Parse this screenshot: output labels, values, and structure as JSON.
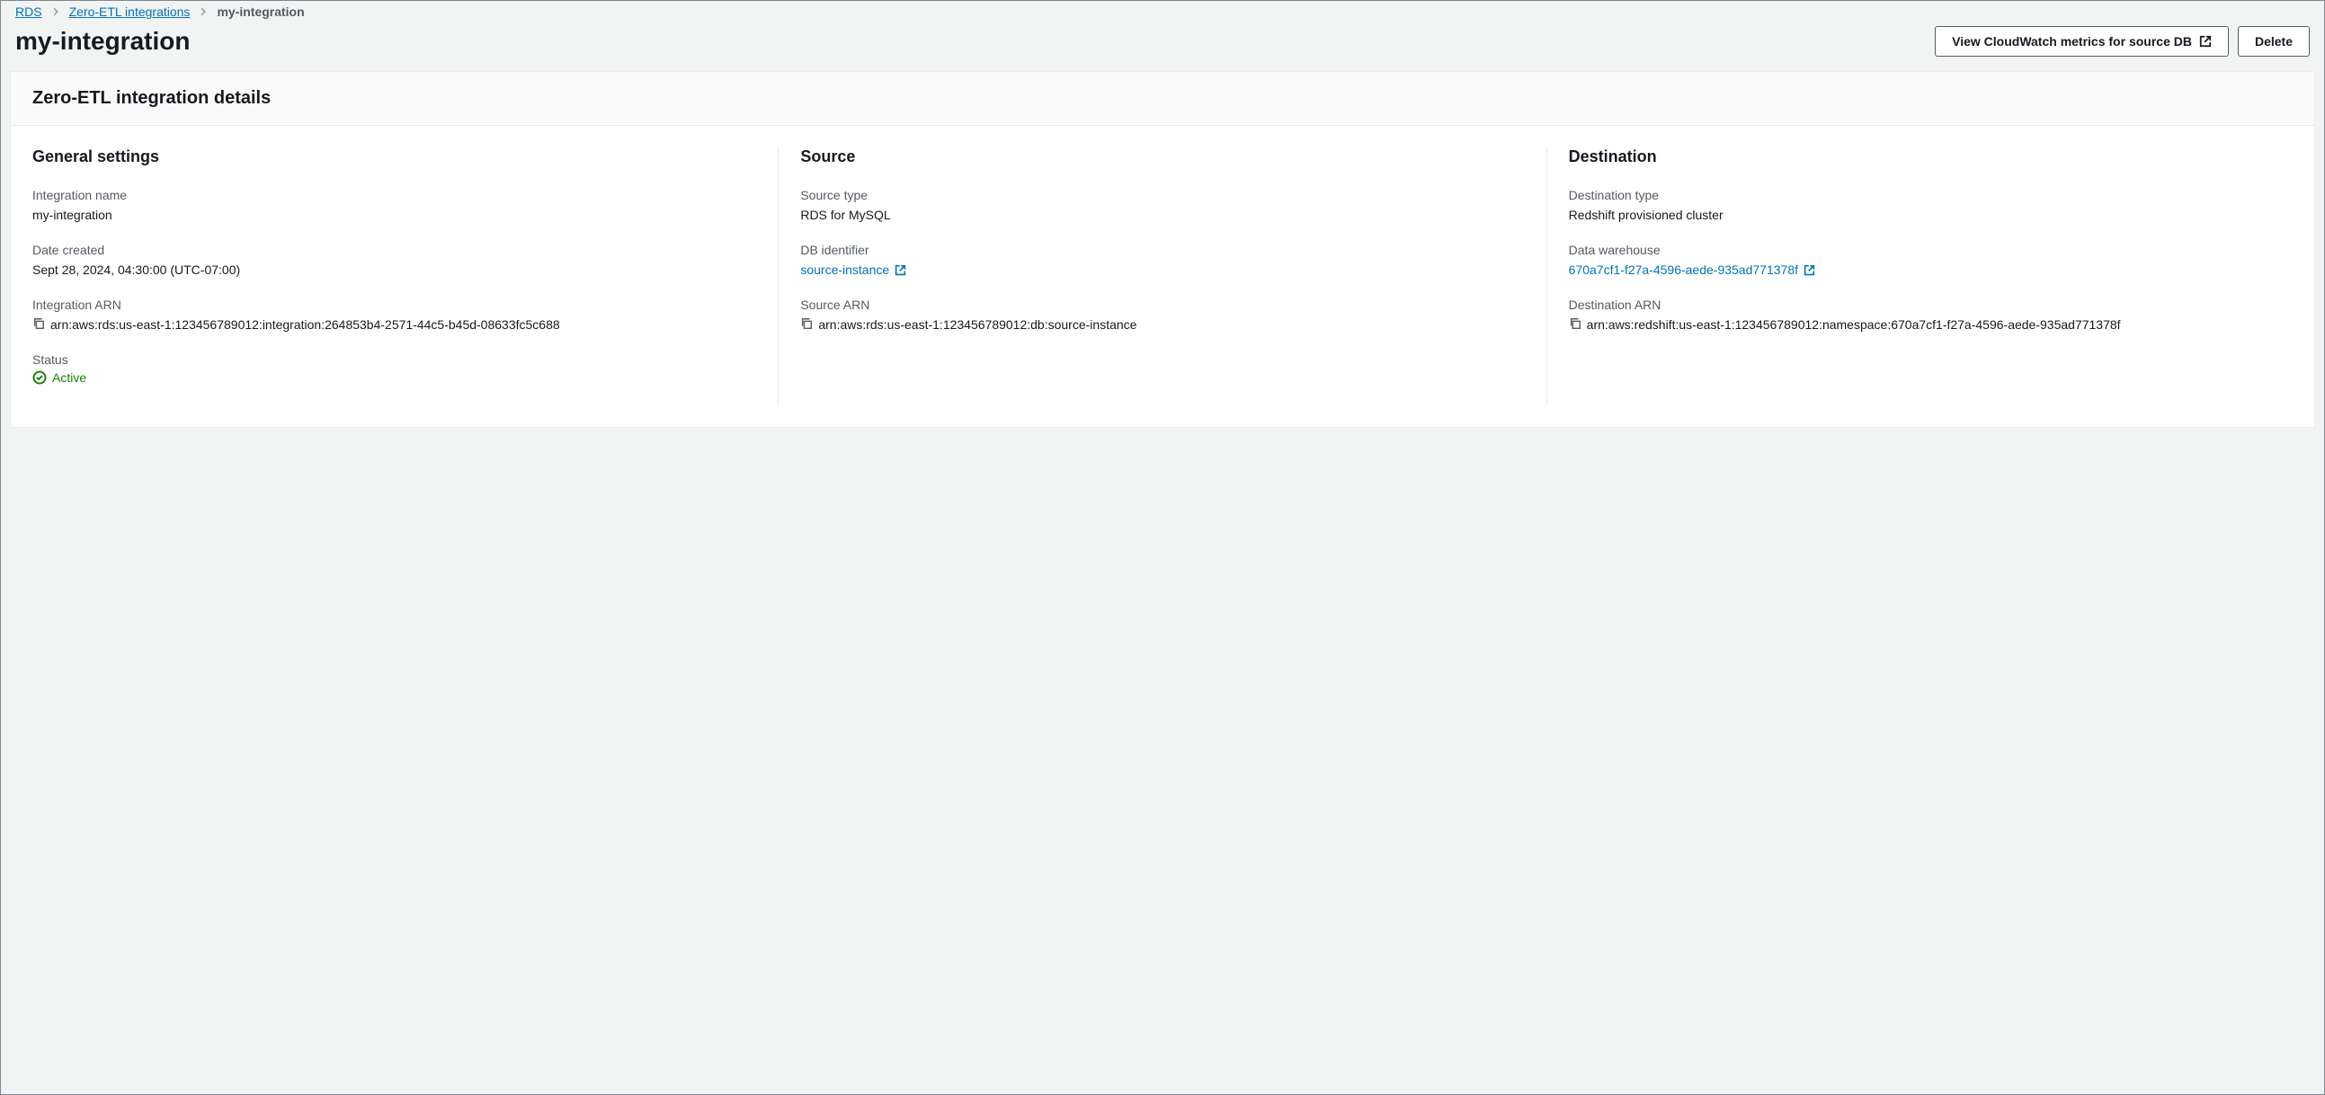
{
  "breadcrumb": {
    "rds": "RDS",
    "zero_etl": "Zero-ETL integrations",
    "current": "my-integration"
  },
  "header": {
    "title": "my-integration",
    "view_metrics_btn": "View CloudWatch metrics for source DB",
    "delete_btn": "Delete"
  },
  "panel": {
    "title": "Zero-ETL integration details"
  },
  "general": {
    "heading": "General settings",
    "integration_name_label": "Integration name",
    "integration_name_value": "my-integration",
    "date_created_label": "Date created",
    "date_created_value": "Sept 28, 2024, 04:30:00 (UTC-07:00)",
    "arn_label": "Integration ARN",
    "arn_value": "arn:aws:rds:us-east-1:123456789012:integration:264853b4-2571-44c5-b45d-08633fc5c688",
    "status_label": "Status",
    "status_value": "Active"
  },
  "source": {
    "heading": "Source",
    "type_label": "Source type",
    "type_value": "RDS for MySQL",
    "db_id_label": "DB identifier",
    "db_id_value": "source-instance",
    "arn_label": "Source ARN",
    "arn_value": "arn:aws:rds:us-east-1:123456789012:db:source-instance"
  },
  "destination": {
    "heading": "Destination",
    "type_label": "Destination type",
    "type_value": "Redshift provisioned cluster",
    "dw_label": "Data warehouse",
    "dw_value": "670a7cf1-f27a-4596-aede-935ad771378f",
    "arn_label": "Destination ARN",
    "arn_value": "arn:aws:redshift:us-east-1:123456789012:namespace:670a7cf1-f27a-4596-aede-935ad771378f"
  }
}
